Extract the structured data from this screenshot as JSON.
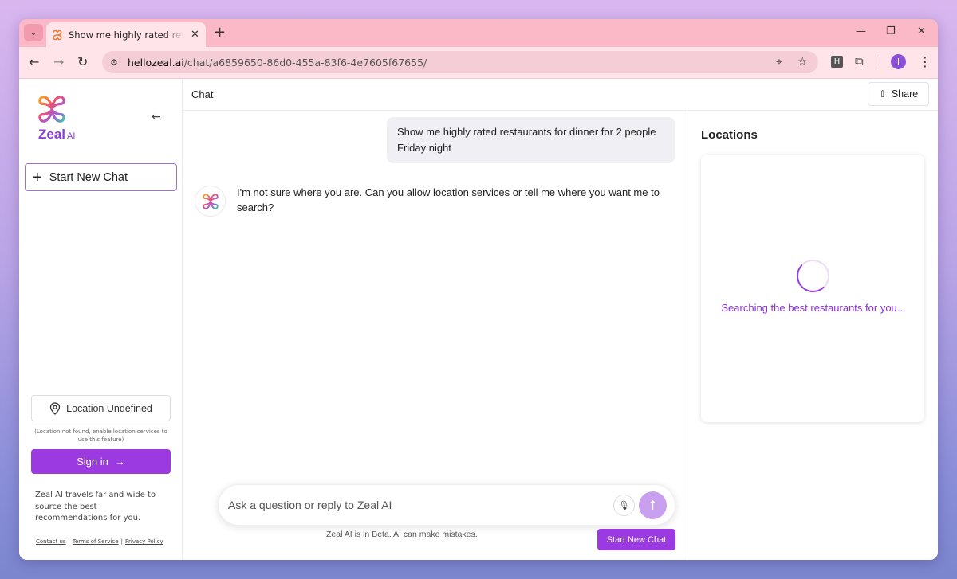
{
  "browser": {
    "tab_title": "Show me highly rated restaurants",
    "tab_close": "✕",
    "new_tab": "+",
    "url_domain": "hellozeal.ai",
    "url_path": "/chat/a6859650-86d0-455a-83f6-4e7605f67655/",
    "extension_label": "H",
    "profile_initial": "J"
  },
  "sidebar": {
    "logo_text": "Zeal",
    "logo_suffix": "AI",
    "start_new_chat": "Start New Chat",
    "location_label": "Location Undefined",
    "location_note": "(Location not found, enable location services to use this feature)",
    "sign_in": "Sign in",
    "description": "Zeal AI travels far and wide to source the best recommendations for you.",
    "links": {
      "contact": "Contact us",
      "terms": "Terms of Service",
      "privacy": "Privacy Policy"
    }
  },
  "header": {
    "title": "Chat",
    "share": "Share"
  },
  "chat": {
    "user_message": "Show me highly rated restaurants for dinner for 2 people Friday night",
    "bot_message": "I'm not sure where you are. Can you allow location services or tell me where you want me to search?",
    "input_placeholder": "Ask a question or reply to Zeal AI",
    "beta_note": "Zeal AI is in Beta. AI can make mistakes.",
    "start_new_chat": "Start New Chat"
  },
  "locations": {
    "title": "Locations",
    "status": "Searching the best restaurants for you..."
  },
  "colors": {
    "accent": "#9a3ae0",
    "tab_bar": "#fbb8c7",
    "toolbar": "#ffe4ea"
  }
}
